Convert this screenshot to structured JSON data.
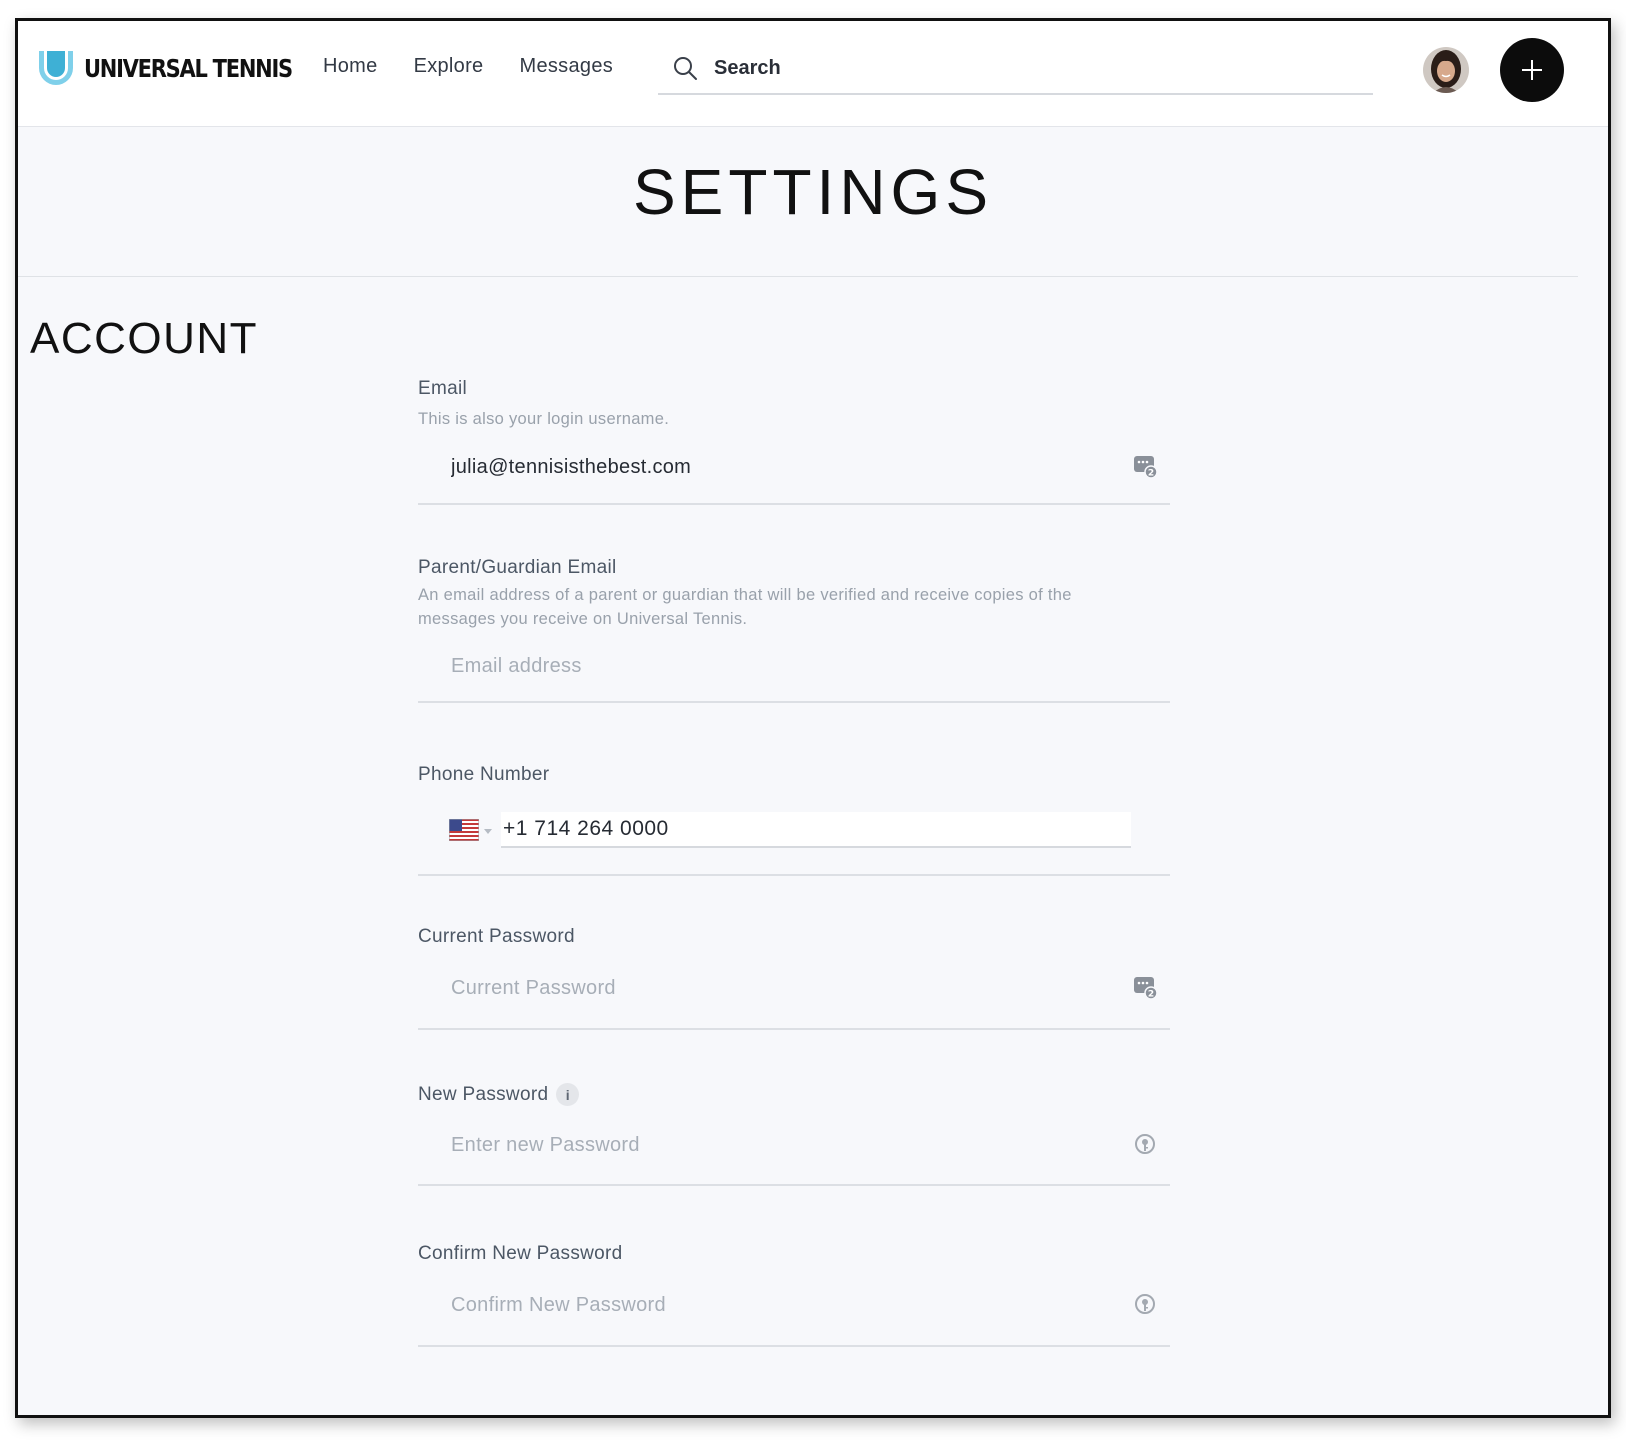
{
  "brand": {
    "name": "UNIVERSAL TENNIS",
    "accent_color": "#4ab4d7"
  },
  "nav": {
    "items": [
      {
        "label": "Home"
      },
      {
        "label": "Explore"
      },
      {
        "label": "Messages"
      }
    ]
  },
  "search": {
    "placeholder": "Search",
    "icon": "search-icon"
  },
  "header_actions": {
    "avatar_icon": "user-avatar",
    "add_icon": "plus-icon"
  },
  "page": {
    "title": "SETTINGS"
  },
  "section": {
    "title": "ACCOUNT"
  },
  "form": {
    "email": {
      "label": "Email",
      "help": "This is also your login username.",
      "value": "julia@tennisisthebest.com",
      "icon": "password-manager-icon"
    },
    "guardian_email": {
      "label": "Parent/Guardian Email",
      "help": "An email address of a parent or guardian that will be verified and receive copies of the messages you receive on Universal Tennis.",
      "placeholder": "Email address"
    },
    "phone": {
      "label": "Phone Number",
      "country_icon": "us-flag-icon",
      "value": "+1 714 264 0000"
    },
    "current_password": {
      "label": "Current Password",
      "placeholder": "Current Password",
      "icon": "password-manager-icon"
    },
    "new_password": {
      "label": "New Password",
      "info": "i",
      "placeholder": "Enter new Password",
      "icon": "key-icon"
    },
    "confirm_password": {
      "label": "Confirm New Password",
      "placeholder": "Confirm New Password",
      "icon": "key-icon"
    }
  }
}
